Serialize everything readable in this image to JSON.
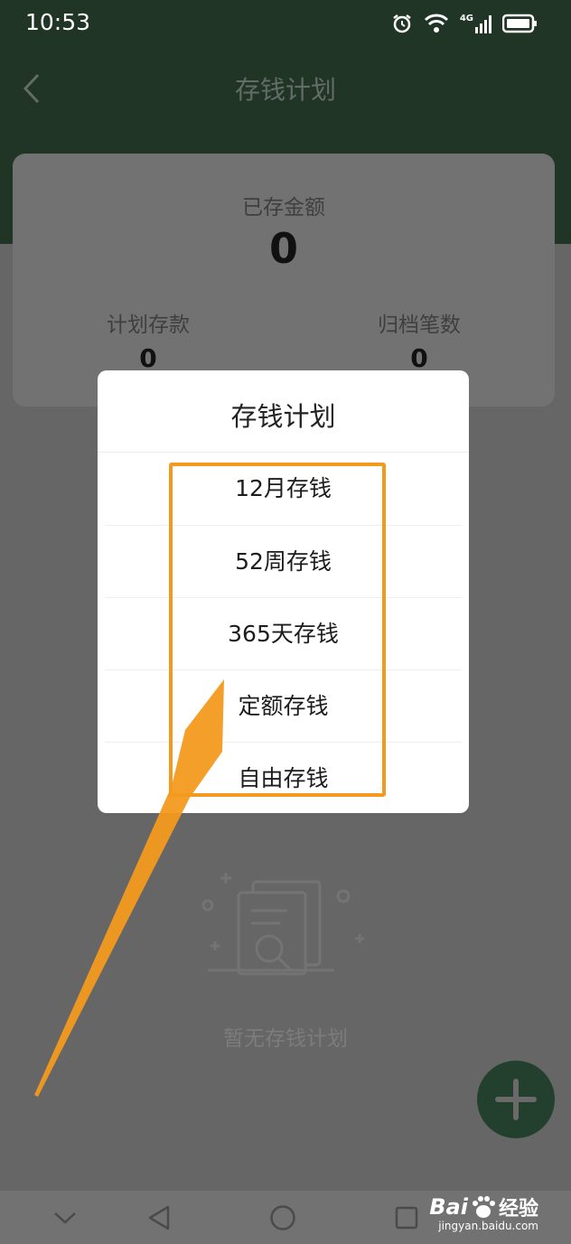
{
  "status_bar": {
    "time": "10:53",
    "network": "4G"
  },
  "header": {
    "title": "存钱计划"
  },
  "summary": {
    "saved_label": "已存金额",
    "saved_value": "0",
    "planned_label": "计划存款",
    "planned_value": "0",
    "archived_label": "归档笔数",
    "archived_value": "0"
  },
  "empty_state": {
    "text": "暂无存钱计划"
  },
  "dialog": {
    "title": "存钱计划",
    "options": [
      "12月存钱",
      "52周存钱",
      "365天存钱",
      "定额存钱",
      "自由存钱"
    ]
  },
  "watermark": {
    "brand": "Bai",
    "brand_cn": "经验",
    "url": "jingyan.baidu.com"
  },
  "colors": {
    "header_bg": "#203526",
    "highlight": "#f29a1d",
    "fab": "#22402d",
    "overlay": "#666666"
  }
}
